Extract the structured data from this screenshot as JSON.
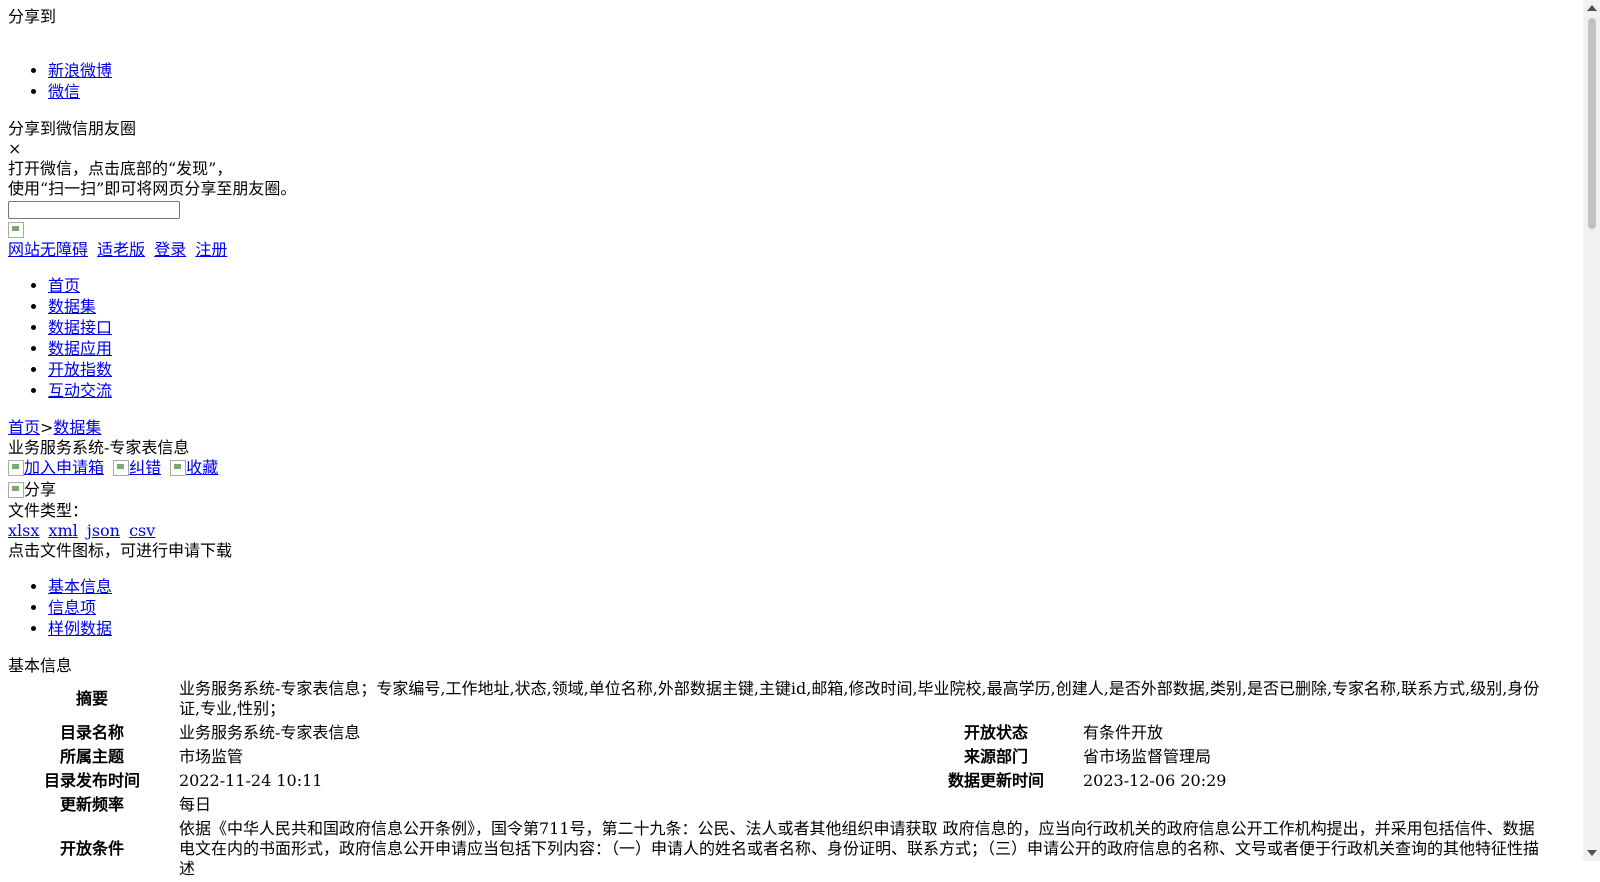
{
  "share": {
    "title": "分享到",
    "items": [
      "新浪微博",
      "微信"
    ],
    "wechat_title": "分享到微信朋友圈",
    "close": "×",
    "hint_line1": "打开微信，点击底部的“发现”，",
    "hint_line2": "使用“扫一扫”即可将网页分享至朋友圈。"
  },
  "top_links": [
    "网站无障碍",
    "适老版",
    "登录",
    "注册"
  ],
  "nav": [
    "首页",
    "数据集",
    "数据接口",
    "数据应用",
    "开放指数",
    "互动交流"
  ],
  "breadcrumb": {
    "home": "首页",
    "sep": ">",
    "current": "数据集"
  },
  "dataset": {
    "title": "业务服务系统-专家表信息",
    "actions": [
      "加入申请箱",
      "纠错",
      "收藏"
    ],
    "share_label": "分享",
    "file_type_label": "文件类型：",
    "file_types": [
      "xlsx",
      "xml",
      "json",
      "csv"
    ],
    "download_hint": "点击文件图标，可进行申请下载"
  },
  "tabs": [
    "基本信息",
    "信息项",
    "样例数据"
  ],
  "basic_info": {
    "section_title": "基本信息",
    "summary_label": "摘要",
    "summary_value": "业务服务系统-专家表信息；专家编号,工作地址,状态,领域,单位名称,外部数据主键,主键id,邮箱,修改时间,毕业院校,最高学历,创建人,是否外部数据,类别,是否已删除,专家名称,联系方式,级别,身份证,专业,性别；",
    "rows": [
      {
        "l1": "目录名称",
        "v1": "业务服务系统-专家表信息",
        "l2": "开放状态",
        "v2": "有条件开放"
      },
      {
        "l1": "所属主题",
        "v1": "市场监管",
        "l2": "来源部门",
        "v2": "省市场监督管理局"
      },
      {
        "l1": "目录发布时间",
        "v1": "2022-11-24 10:11",
        "l2": "数据更新时间",
        "v2": "2023-12-06 20:29"
      }
    ],
    "freq_label": "更新频率",
    "freq_value": "每日",
    "cond_label": "开放条件",
    "cond_value": "依据《中华人民共和国政府信息公开条例》，国令第711号，第二十九条：公民、法人或者其他组织申请获取 政府信息的，应当向行政机关的政府信息公开工作机构提出，并采用包括信件、数据电文在内的书面形式，政府信息公开申请应当包括下列内容：（一）申请人的姓名或者名称、身份证明、联系方式；（三）申请公开的政府信息的名称、文号或者便于行政机关查询的其他特征性描述"
  }
}
